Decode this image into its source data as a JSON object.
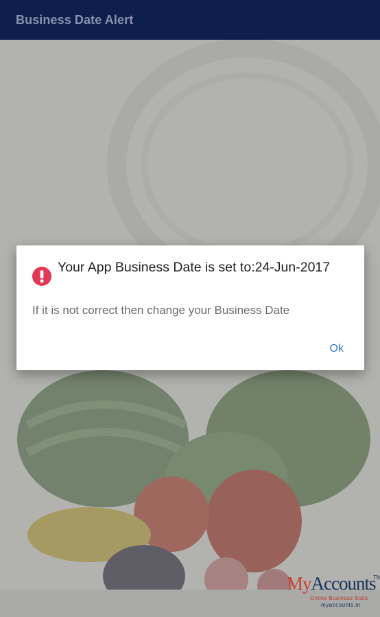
{
  "appbar": {
    "title": "Business Date Alert"
  },
  "dialog": {
    "icon": "alert-circle-icon",
    "title": "Your App Business Date is set to:24-Jun-2017",
    "message": "If it is not correct then change your Business Date",
    "ok_label": "Ok"
  },
  "logo": {
    "brand_prefix": "My",
    "brand_suffix": "Accounts",
    "trademark": "TM",
    "tagline": "Online Business Suite",
    "url": "myaccounts.in"
  },
  "colors": {
    "appbar": "#0e1f4d",
    "alert_icon": "#e23a55",
    "ok_button": "#2b7cc6"
  }
}
